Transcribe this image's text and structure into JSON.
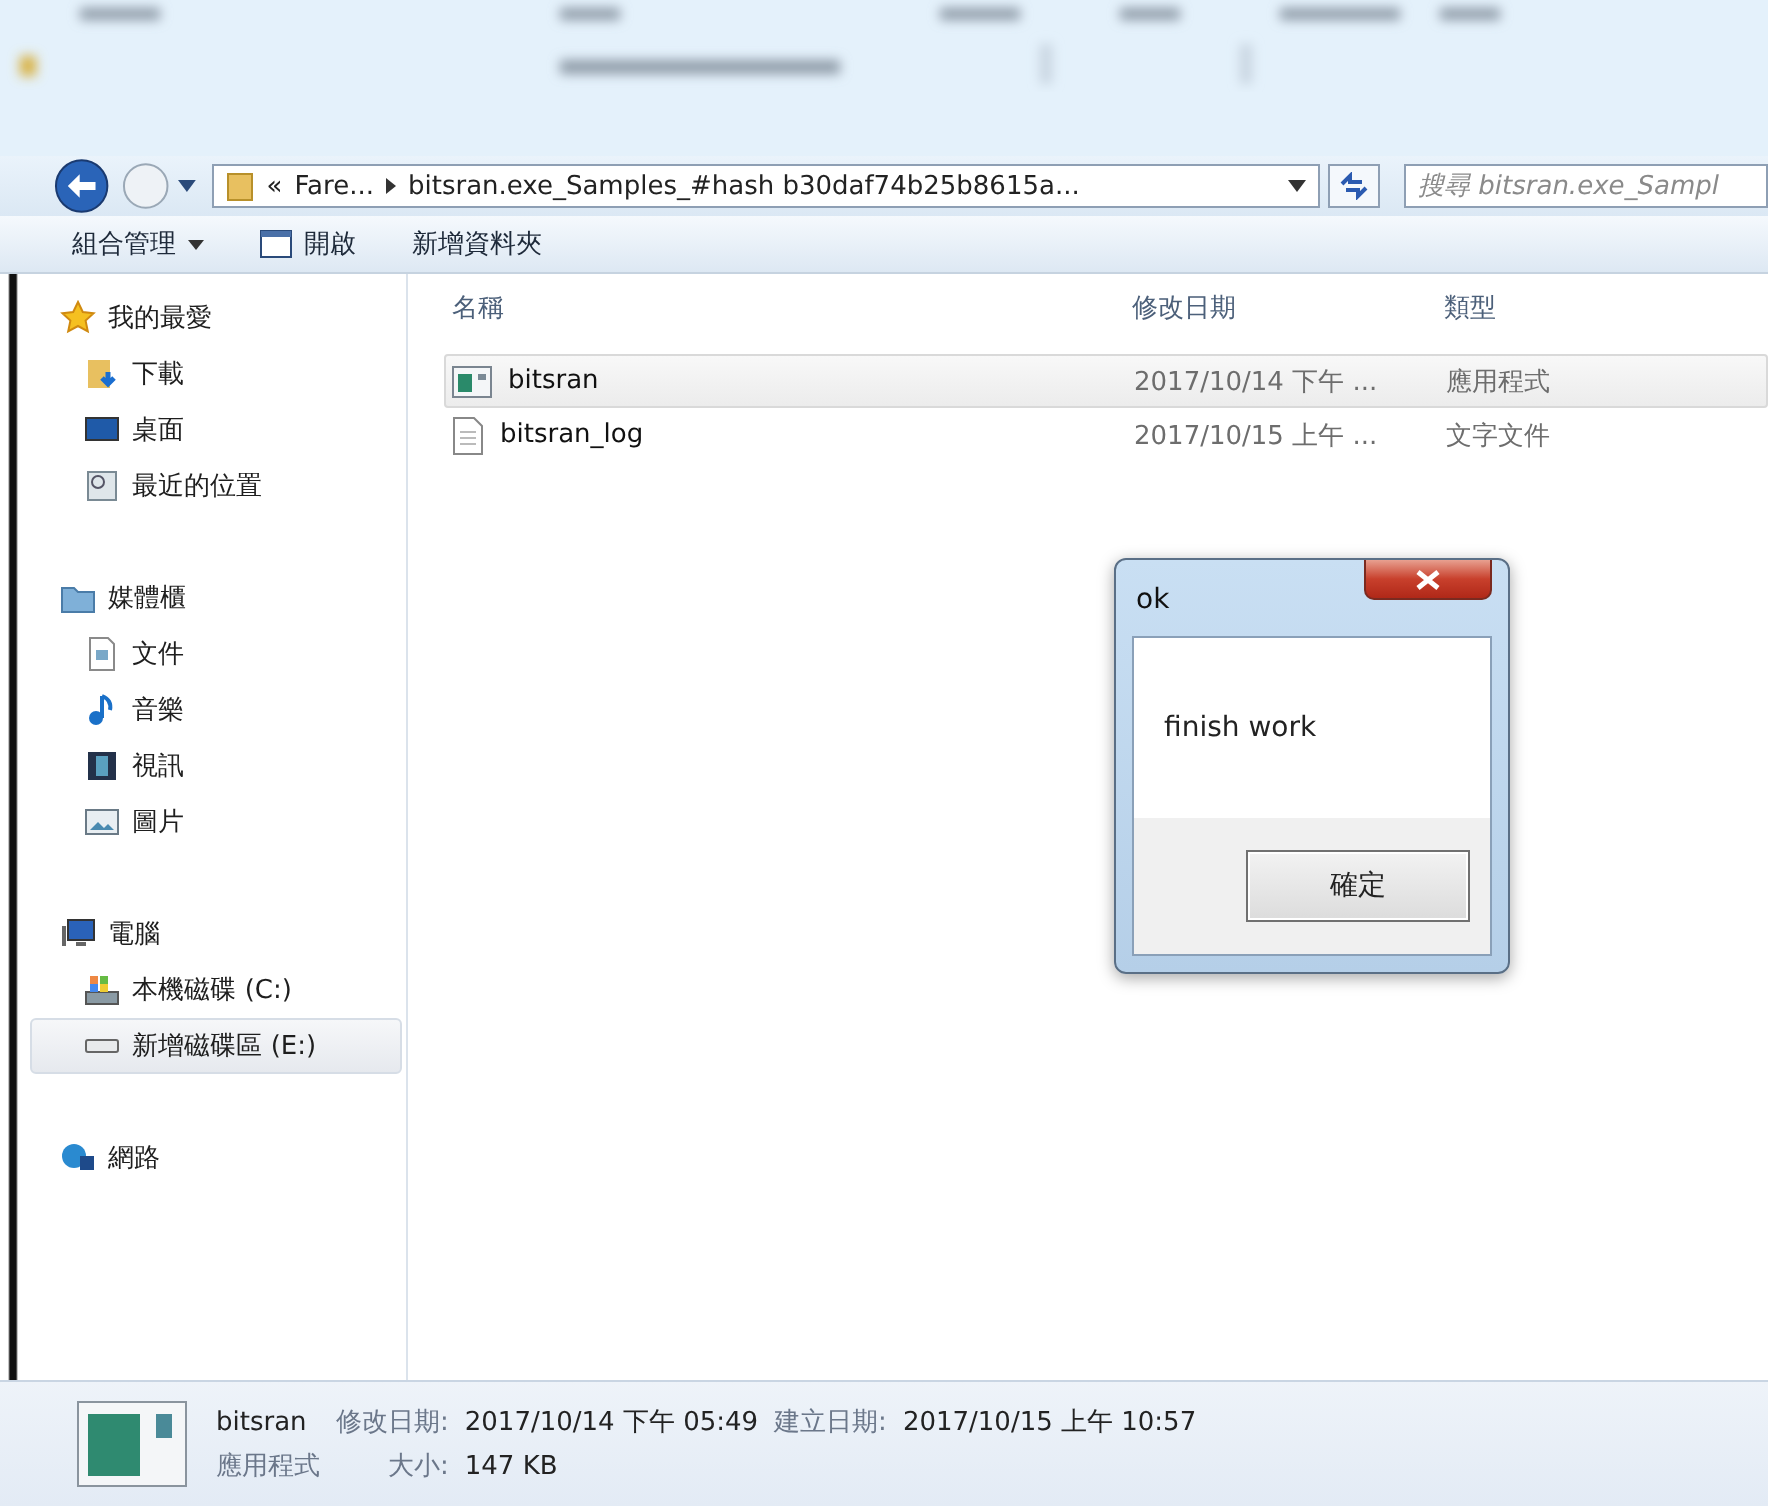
{
  "address": {
    "crumbs": [
      "«",
      "Fare...",
      "bitsran.exe_Samples_#hash b30daf74b25b8615a..."
    ]
  },
  "search": {
    "placeholder": "搜尋 bitsran.exe_Sampl"
  },
  "toolbar": [
    {
      "label": "組合管理",
      "kind": "menu"
    },
    {
      "label": "開啟",
      "kind": "open"
    },
    {
      "label": "新增資料夾",
      "kind": "plain"
    }
  ],
  "sidebar": [
    {
      "label": "我的最愛",
      "kind": "star",
      "selected": false,
      "children": [
        {
          "label": "下載",
          "kind": "download",
          "selected": false
        },
        {
          "label": "桌面",
          "kind": "desktop",
          "selected": false
        },
        {
          "label": "最近的位置",
          "kind": "recent",
          "selected": false
        }
      ]
    },
    {
      "label": "媒體櫃",
      "kind": "library",
      "selected": false,
      "children": [
        {
          "label": "文件",
          "kind": "doc",
          "selected": false
        },
        {
          "label": "音樂",
          "kind": "music",
          "selected": false
        },
        {
          "label": "視訊",
          "kind": "video",
          "selected": false
        },
        {
          "label": "圖片",
          "kind": "picture",
          "selected": false
        }
      ]
    },
    {
      "label": "電腦",
      "kind": "computer",
      "selected": false,
      "children": [
        {
          "label": "本機磁碟 (C:)",
          "kind": "system-drive",
          "selected": false
        },
        {
          "label": "新增磁碟區 (E:)",
          "kind": "drive",
          "selected": true
        }
      ]
    },
    {
      "label": "網路",
      "kind": "network",
      "selected": false
    }
  ],
  "columns": [
    "名稱",
    "修改日期",
    "類型"
  ],
  "rows": [
    {
      "name": "bitsran",
      "modified": "2017/10/14 下午 ...",
      "type": "應用程式",
      "kind": "app",
      "selected": true
    },
    {
      "name": "bitsran_log",
      "modified": "2017/10/15 上午 ...",
      "type": "文字文件",
      "kind": "text",
      "selected": false
    }
  ],
  "dialog": {
    "title": "ok",
    "message": "finish work",
    "button": "確定"
  },
  "status": {
    "name": "bitsran",
    "modified_label": "修改日期:",
    "modified": "2017/10/14 下午 05:49",
    "created_label": "建立日期:",
    "created": "2017/10/15 上午 10:57",
    "type": "應用程式",
    "size_label": "大小:",
    "size": "147 KB"
  }
}
